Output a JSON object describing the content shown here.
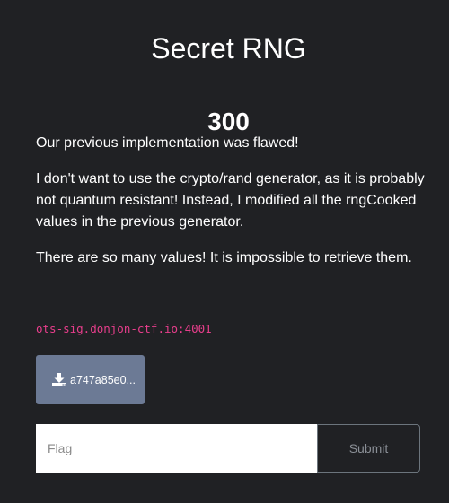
{
  "challenge": {
    "title": "Secret RNG",
    "points": "300",
    "description": [
      "Our previous implementation was flawed!",
      "I don't want to use the crypto/rand generator, as it is probably not quantum resistant! Instead, I modified all the rngCooked values in the previous generator.",
      "There are so many values! It is impossible to retrieve them."
    ],
    "connection": "ots-sig.donjon-ctf.io:4001"
  },
  "files": [
    {
      "label": "a747a85e0...",
      "icon": "download-icon"
    }
  ],
  "flag_form": {
    "placeholder": "Flag",
    "value": "",
    "submit_label": "Submit"
  },
  "colors": {
    "background": "#202124",
    "connection_text": "#e83e8c",
    "file_button": "#6c7a95"
  }
}
